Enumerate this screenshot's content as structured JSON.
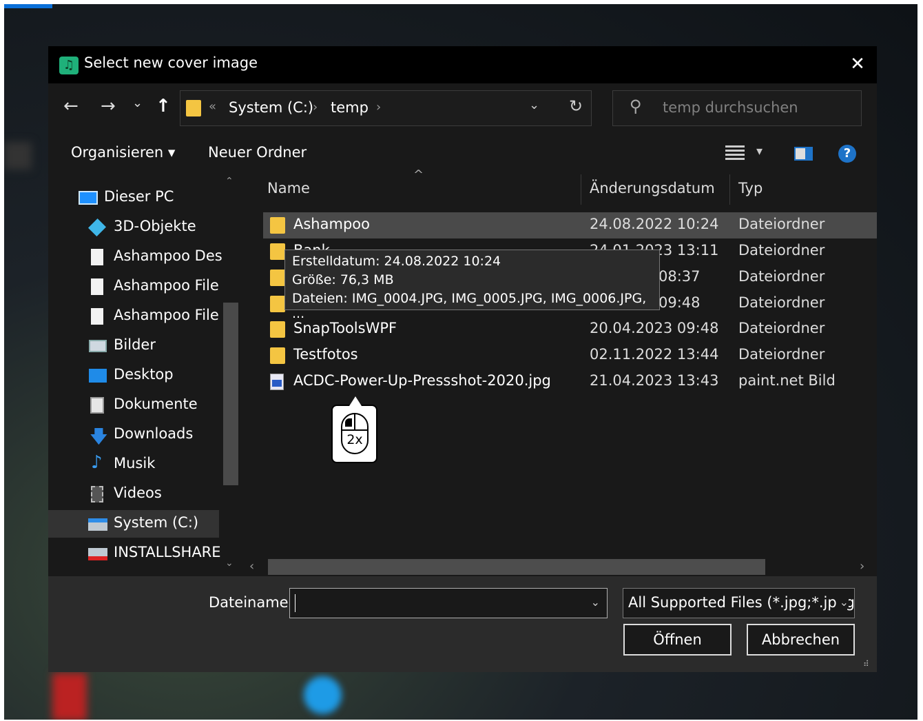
{
  "dialog": {
    "title": "Select new cover image",
    "close_glyph": "✕"
  },
  "nav": {
    "back_glyph": "←",
    "forward_glyph": "→",
    "recent_glyph": "⌄",
    "up_glyph": "↑",
    "breadcrumb_prefix": "«",
    "breadcrumbs": [
      "System (C:)",
      "temp"
    ],
    "crumb_sep": "›",
    "refresh_glyph": "↻",
    "dropdown_glyph": "⌄",
    "search_placeholder": "temp durchsuchen",
    "search_icon": "⚲"
  },
  "toolbar": {
    "organize_label": "Organisieren ▾",
    "new_folder_label": "Neuer Ordner",
    "view_dropdown_glyph": "▾",
    "help_glyph": "?"
  },
  "sidebar": {
    "items": [
      {
        "label": "Dieser PC",
        "icon": "monitor-icon"
      },
      {
        "label": "3D-Objekte",
        "icon": "cube-icon"
      },
      {
        "label": "Ashampoo Desiç",
        "icon": "document-icon"
      },
      {
        "label": "Ashampoo File S",
        "icon": "document-icon"
      },
      {
        "label": "Ashampoo File S",
        "icon": "document-icon"
      },
      {
        "label": "Bilder",
        "icon": "pictures-icon"
      },
      {
        "label": "Desktop",
        "icon": "desktop-icon"
      },
      {
        "label": "Dokumente",
        "icon": "documents-icon"
      },
      {
        "label": "Downloads",
        "icon": "download-arrow-icon"
      },
      {
        "label": "Musik",
        "icon": "music-note-icon"
      },
      {
        "label": "Videos",
        "icon": "film-icon"
      },
      {
        "label": "System (C:)",
        "icon": "system-drive-icon"
      },
      {
        "label": "INSTALLSHARE (",
        "icon": "network-drive-icon"
      }
    ],
    "scroll_up_glyph": "⌃",
    "scroll_down_glyph": "⌄"
  },
  "filelist": {
    "columns": [
      "Name",
      "Änderungsdatum",
      "Typ"
    ],
    "sort_glyph": "^",
    "rows": [
      {
        "name": "Ashampoo",
        "date": "24.08.2022 10:24",
        "type": "Dateiordner",
        "kind": "folder"
      },
      {
        "name": "Bank",
        "date": "24.01.2023 13:11",
        "type": "Dateiordner",
        "kind": "folder"
      },
      {
        "name": "",
        "date": "08:37",
        "type": "Dateiordner",
        "kind": "folder"
      },
      {
        "name": "",
        "date": "09:48",
        "type": "Dateiordner",
        "kind": "folder"
      },
      {
        "name": "SnapToolsWPF",
        "date": "20.04.2023 09:48",
        "type": "Dateiordner",
        "kind": "folder"
      },
      {
        "name": "Testfotos",
        "date": "02.11.2022 13:44",
        "type": "Dateiordner",
        "kind": "folder"
      },
      {
        "name": "ACDC-Power-Up-Pressshot-2020.jpg",
        "date": "21.04.2023 13:43",
        "type": "paint.net Bild",
        "kind": "image"
      }
    ]
  },
  "tooltip": {
    "lines": [
      "Erstelldatum: 24.08.2022 10:24",
      "Größe: 76,3 MB",
      "Dateien: IMG_0004.JPG, IMG_0005.JPG, IMG_0006.JPG, ..."
    ]
  },
  "hscroll": {
    "left_glyph": "‹",
    "right_glyph": "›"
  },
  "bottom": {
    "filename_label": "Dateiname:",
    "filename_value": "",
    "filename_dd": "⌄",
    "filter_value": "All Supported Files (*.jpg;*.jpeg",
    "filter_dd": "⌄",
    "open_label": "Öffnen",
    "cancel_label": "Abbrechen",
    "grip_glyph": "⠾"
  },
  "hint": {
    "double_click_label": "2x"
  },
  "colors": {
    "accent": "#1e73c8",
    "folder": "#f4c542",
    "app_icon": "#1fb07a"
  }
}
